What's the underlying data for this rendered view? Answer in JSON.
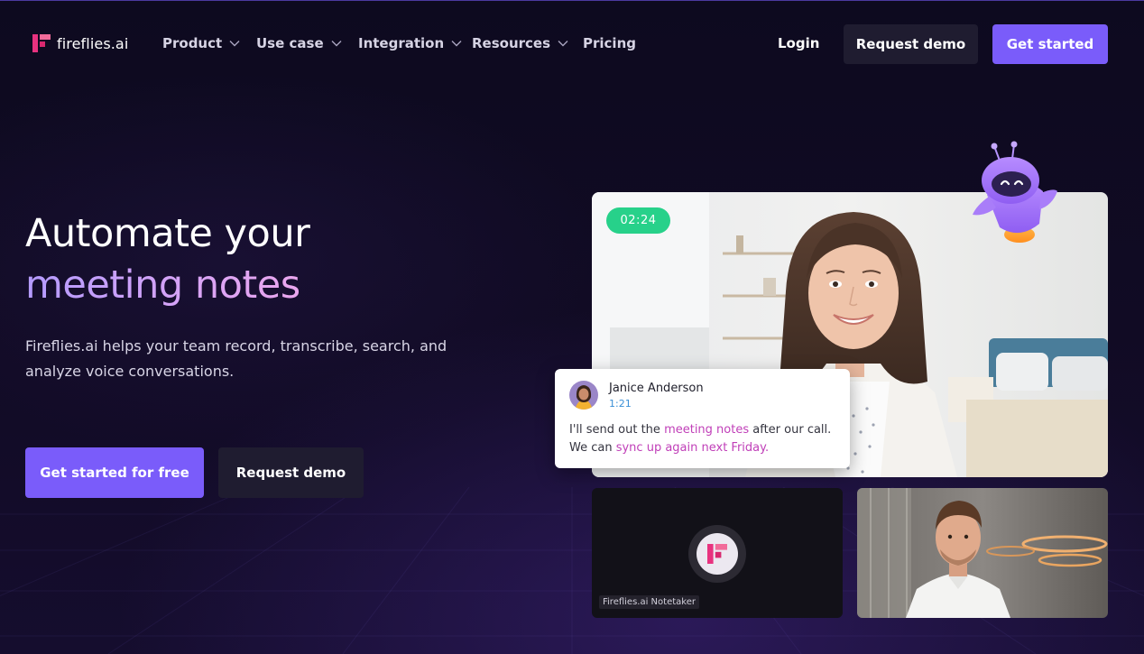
{
  "nav": {
    "logo_text": "fireflies.ai",
    "items": [
      {
        "label": "Product",
        "has_dropdown": true
      },
      {
        "label": "Use case",
        "has_dropdown": true
      },
      {
        "label": "Integration",
        "has_dropdown": true
      },
      {
        "label": "Resources",
        "has_dropdown": true
      },
      {
        "label": "Pricing",
        "has_dropdown": false
      }
    ],
    "login_label": "Login",
    "request_demo_label": "Request demo",
    "get_started_label": "Get started"
  },
  "hero": {
    "title_line1": "Automate your",
    "title_line2": "meeting notes",
    "subtitle": "Fireflies.ai helps your team record, transcribe, search, and analyze voice conversations.",
    "cta_primary": "Get started for free",
    "cta_secondary": "Request demo"
  },
  "video": {
    "timer": "02:24",
    "chat": {
      "name": "Janice Anderson",
      "time": "1:21",
      "msg_part1": "I'll send out the ",
      "msg_highlight1": "meeting notes",
      "msg_part2": " after our call. We can ",
      "msg_highlight2": "sync up again next Friday."
    },
    "notetaker_label": "Fireflies.ai Notetaker"
  },
  "colors": {
    "accent": "#7a5cfa",
    "timer_green": "#27d18a",
    "highlight_pink": "#c03fb8",
    "brand_pink": "#e8327f"
  }
}
